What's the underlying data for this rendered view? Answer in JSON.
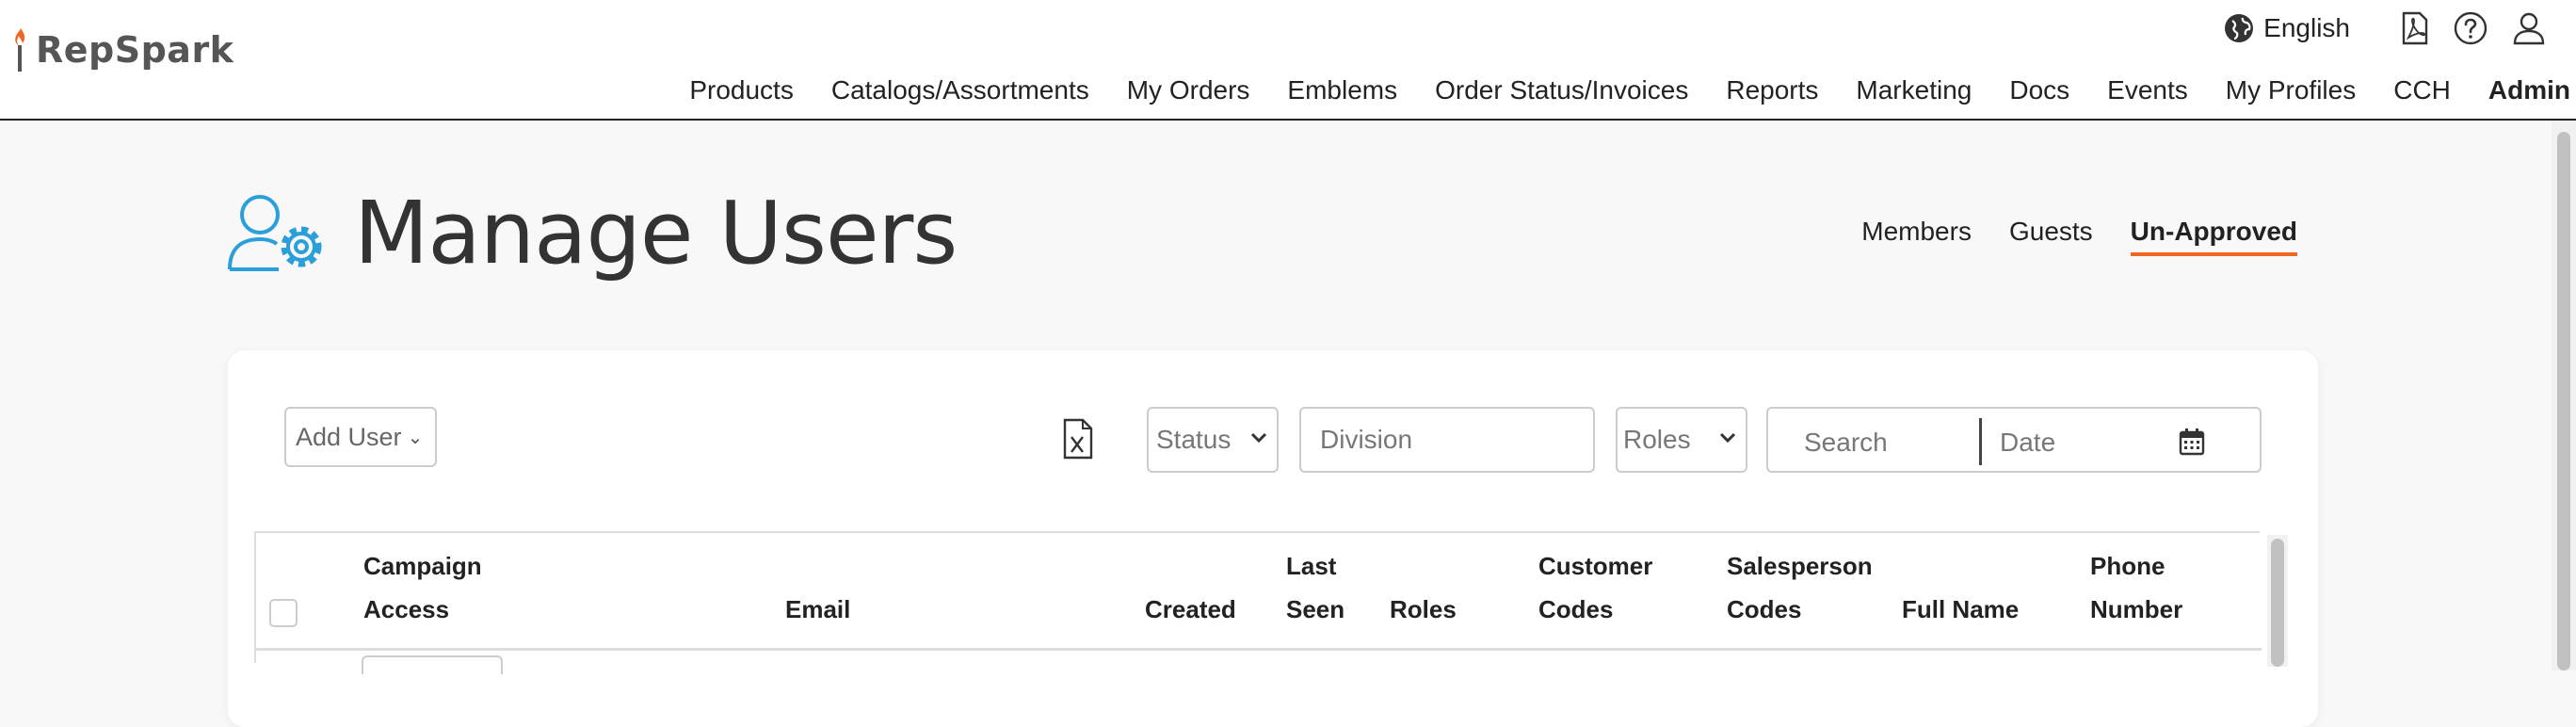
{
  "header": {
    "brand": "RepSpark",
    "language": "English",
    "nav": [
      {
        "label": "Products"
      },
      {
        "label": "Catalogs/Assortments"
      },
      {
        "label": "My Orders"
      },
      {
        "label": "Emblems"
      },
      {
        "label": "Order Status/Invoices"
      },
      {
        "label": "Reports"
      },
      {
        "label": "Marketing"
      },
      {
        "label": "Docs"
      },
      {
        "label": "Events"
      },
      {
        "label": "My Profiles"
      },
      {
        "label": "CCH"
      },
      {
        "label": "Admin",
        "active": true
      }
    ]
  },
  "page": {
    "title": "Manage Users",
    "tabs": [
      {
        "label": "Members"
      },
      {
        "label": "Guests"
      },
      {
        "label": "Un-Approved",
        "active": true
      }
    ]
  },
  "toolbar": {
    "add_user_label": "Add User",
    "status_label": "Status",
    "division_placeholder": "Division",
    "roles_label": "Roles",
    "search_placeholder": "Search",
    "date_placeholder": "Date"
  },
  "table": {
    "columns": [
      {
        "line1": "Campaign",
        "line2": "Access"
      },
      {
        "line1": "",
        "line2": "Email"
      },
      {
        "line1": "",
        "line2": "Created"
      },
      {
        "line1": "Last",
        "line2": "Seen"
      },
      {
        "line1": "",
        "line2": "Roles"
      },
      {
        "line1": "Customer",
        "line2": "Codes"
      },
      {
        "line1": "Salesperson",
        "line2": "Codes"
      },
      {
        "line1": "",
        "line2": "Full Name"
      },
      {
        "line1": "Phone",
        "line2": "Number"
      }
    ]
  },
  "colors": {
    "accent": "#f26522",
    "icon_blue": "#2b9fd9"
  },
  "icons": {
    "language": "globe-icon",
    "pdf": "pdf-icon",
    "help": "help-icon",
    "account": "user-icon",
    "title": "user-settings-icon",
    "export": "excel-icon",
    "calendar": "calendar-icon"
  }
}
